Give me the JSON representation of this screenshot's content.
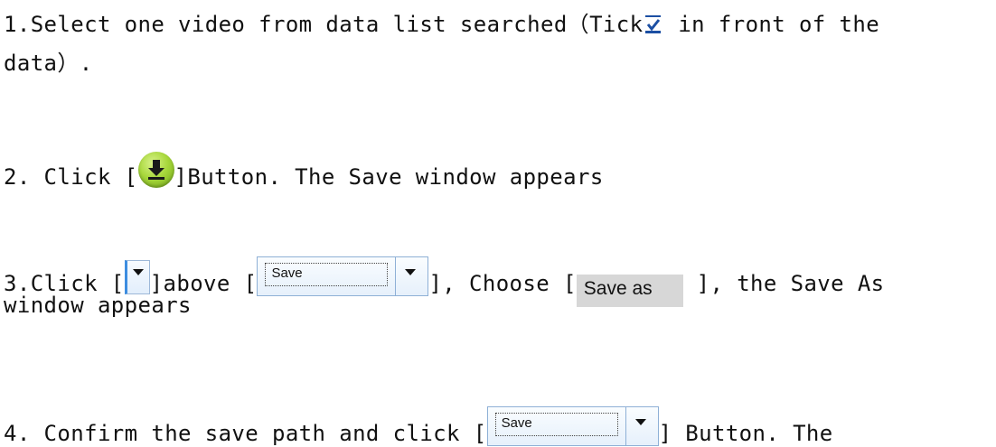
{
  "step1": {
    "text_a": "1.Select one video from data list searched（Tick",
    "text_b": " in front of the",
    "text_c": "data）."
  },
  "step2": {
    "text_a": "2. Click [",
    "text_b": "]Button. The Save window appears",
    "icon": "download-icon"
  },
  "step3": {
    "text_a": "3.Click [",
    "text_b": "]above [",
    "text_c": "], Choose [",
    "text_d": " ], the Save As",
    "text_e": "window appears",
    "split_label": "Save",
    "saveas_label": "Save as"
  },
  "step4": {
    "text_a": "4. Confirm the save path and click [",
    "text_b": "] Button. The",
    "split_label": "Save"
  },
  "colors": {
    "checkbox": "#1c4fa3",
    "download_icon": "#8cc63f",
    "split_border": "#8eb0d6",
    "saveas_bg": "#d7d7d7"
  }
}
